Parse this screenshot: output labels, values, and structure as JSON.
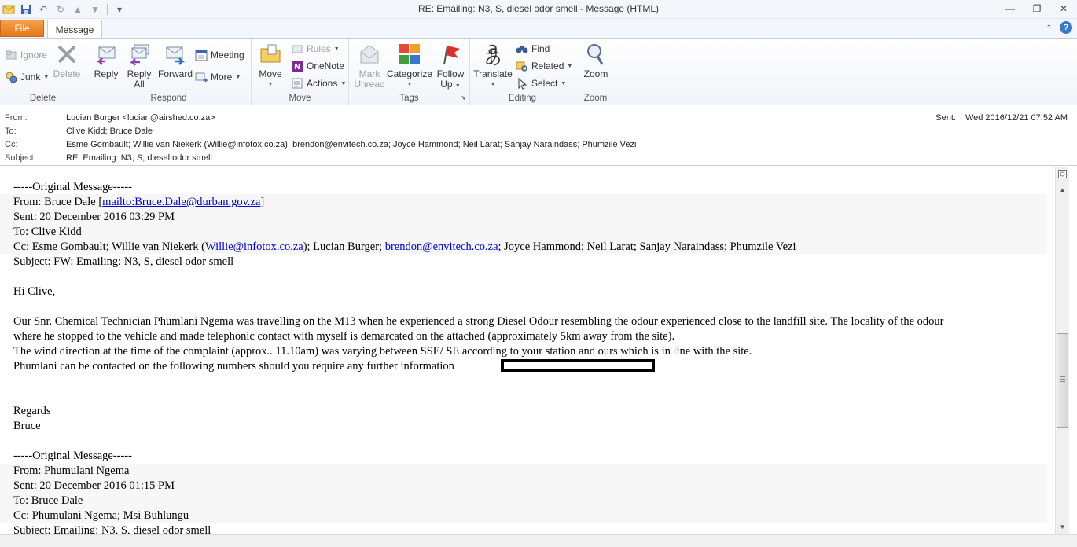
{
  "window": {
    "title": "RE: Emailing: N3, S, diesel odor smell  -  Message (HTML)",
    "controls": [
      "minimize",
      "restore",
      "close"
    ]
  },
  "tabs": {
    "file": "File",
    "message": "Message"
  },
  "ribbon": {
    "groups": {
      "delete": "Delete",
      "respond": "Respond",
      "move": "Move",
      "tags": "Tags",
      "editing": "Editing",
      "zoom": "Zoom"
    },
    "ignore": "Ignore",
    "junk": "Junk",
    "delete_btn": "Delete",
    "reply": "Reply",
    "reply_all_1": "Reply",
    "reply_all_2": "All",
    "forward": "Forward",
    "meeting": "Meeting",
    "more": "More",
    "move_btn": "Move",
    "rules": "Rules",
    "onenote": "OneNote",
    "actions": "Actions",
    "mark_unread_1": "Mark",
    "mark_unread_2": "Unread",
    "categorize": "Categorize",
    "follow_up_1": "Follow",
    "follow_up_2": "Up",
    "translate": "Translate",
    "find": "Find",
    "related": "Related",
    "select": "Select",
    "zoom_btn": "Zoom"
  },
  "header": {
    "from_label": "From:",
    "from": "Lucian Burger <lucian@airshed.co.za>",
    "to_label": "To:",
    "to": "Clive Kidd; Bruce Dale",
    "cc_label": "Cc:",
    "cc": "Esme Gombault; Willie van Niekerk (Willie@infotox.co.za); brendon@envitech.co.za; Joyce Hammond; Neil Larat; Sanjay Naraindass; Phumzile Vezi",
    "subject_label": "Subject:",
    "subject": "RE: Emailing: N3, S, diesel odor smell",
    "sent_label": "Sent:",
    "sent": "Wed 2016/12/21 07:52 AM"
  },
  "body": {
    "orig1_sep": "-----Original Message-----",
    "orig1_from_prefix": "From: Bruce Dale [",
    "orig1_from_link": "mailto:Bruce.Dale@durban.gov.za",
    "orig1_from_suffix": "]",
    "orig1_sent": "Sent: 20 December 2016 03:29 PM",
    "orig1_to": "To: Clive Kidd",
    "orig1_cc_a": "Cc: Esme Gombault; Willie van Niekerk (",
    "orig1_cc_link1": "Willie@infotox.co.za",
    "orig1_cc_b": "); Lucian Burger; ",
    "orig1_cc_link2": "brendon@envitech.co.za",
    "orig1_cc_c": "; Joyce Hammond; Neil Larat; Sanjay Naraindass; Phumzile Vezi",
    "orig1_subject": "Subject: FW: Emailing: N3, S, diesel odor smell",
    "greeting": "Hi Clive,",
    "para1_l1": "Our Snr. Chemical Technician Phumlani Ngema was travelling on the M13 when he experienced a strong Diesel Odour resembling the odour experienced close to the landfill site. The locality of the odour",
    "para1_l2": "where he stopped to the vehicle and made telephonic contact with myself is demarcated on the attached (approximately 5km away from the site).",
    "para2": "The wind direction at the time of the complaint (approx.. 11.10am) was varying between SSE/ SE according to your station and ours which is in line with the site.",
    "para3": "Phumlani can be contacted on the following numbers should you require any further information",
    "regards": "Regards",
    "signature": "Bruce",
    "orig2_sep": "-----Original Message-----",
    "orig2_from": "From: Phumulani Ngema",
    "orig2_sent": "Sent: 20 December 2016 01:15 PM",
    "orig2_to": "To: Bruce Dale",
    "orig2_cc": "Cc: Phumulani Ngema; Msi Buhlungu",
    "orig2_subject": "Subject: Emailing: N3, S, diesel odor smell"
  }
}
